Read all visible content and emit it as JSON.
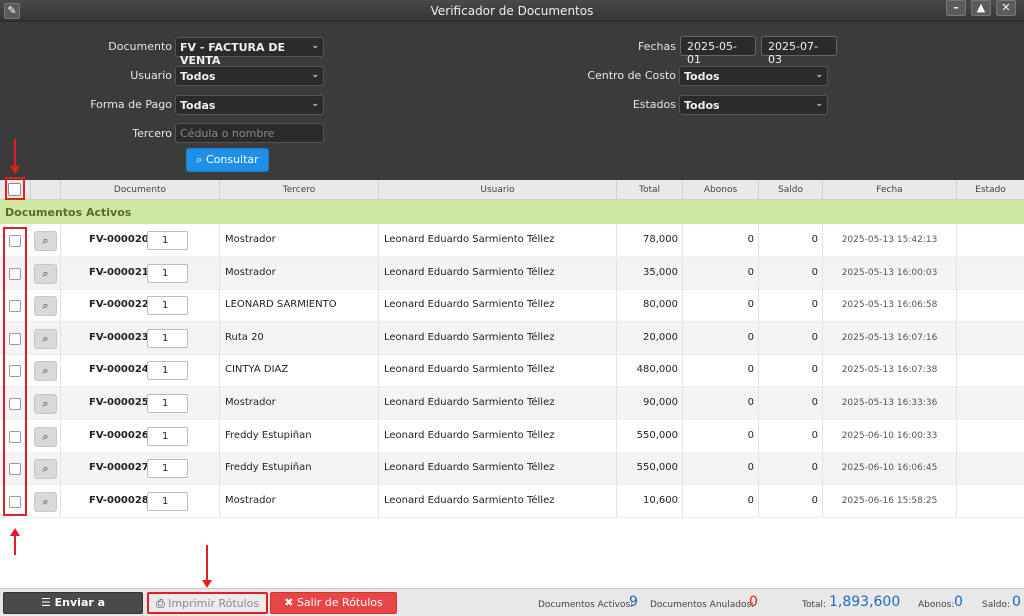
{
  "window": {
    "title": "Verificador de Documentos",
    "controls": [
      "–",
      "▲",
      "✕"
    ]
  },
  "filters": {
    "documento_label": "Documento",
    "documento_value": "FV - FACTURA DE VENTA",
    "usuario_label": "Usuario",
    "usuario_value": "Todos",
    "forma_pago_label": "Forma de Pago",
    "forma_pago_value": "Todas",
    "tercero_label": "Tercero",
    "tercero_placeholder": "Cédula o nombre",
    "fechas_label": "Fechas",
    "fecha_desde": "2025-05-01",
    "fecha_hasta": "2025-07-03",
    "centro_costo_label": "Centro de Costo",
    "centro_costo_value": "Todos",
    "estados_label": "Estados",
    "estados_value": "Todos",
    "consultar_label": "Consultar"
  },
  "table": {
    "columns": [
      "Documento",
      "Tercero",
      "Usuario",
      "Total",
      "Abonos",
      "Saldo",
      "Fecha",
      "Estado"
    ],
    "group_label": "Documentos Activos",
    "rows": [
      {
        "doc": "FV-000020",
        "qty": "1",
        "tercero": "Mostrador",
        "usuario": "Leonard Eduardo Sarmiento Téllez",
        "total": "78,000",
        "abonos": "0",
        "saldo": "0",
        "fecha": "2025-05-13 15:42:13",
        "estado": ""
      },
      {
        "doc": "FV-000021",
        "qty": "1",
        "tercero": "Mostrador",
        "usuario": "Leonard Eduardo Sarmiento Téllez",
        "total": "35,000",
        "abonos": "0",
        "saldo": "0",
        "fecha": "2025-05-13 16:00:03",
        "estado": ""
      },
      {
        "doc": "FV-000022",
        "qty": "1",
        "tercero": "LEONARD SARMIENTO",
        "usuario": "Leonard Eduardo Sarmiento Téllez",
        "total": "80,000",
        "abonos": "0",
        "saldo": "0",
        "fecha": "2025-05-13 16:06:58",
        "estado": ""
      },
      {
        "doc": "FV-000023",
        "qty": "1",
        "tercero": "Ruta 20",
        "usuario": "Leonard Eduardo Sarmiento Téllez",
        "total": "20,000",
        "abonos": "0",
        "saldo": "0",
        "fecha": "2025-05-13 16:07:16",
        "estado": ""
      },
      {
        "doc": "FV-000024",
        "qty": "1",
        "tercero": "CINTYA DIAZ",
        "usuario": "Leonard Eduardo Sarmiento Téllez",
        "total": "480,000",
        "abonos": "0",
        "saldo": "0",
        "fecha": "2025-05-13 16:07:38",
        "estado": ""
      },
      {
        "doc": "FV-000025",
        "qty": "1",
        "tercero": "Mostrador",
        "usuario": "Leonard Eduardo Sarmiento Téllez",
        "total": "90,000",
        "abonos": "0",
        "saldo": "0",
        "fecha": "2025-05-13 16:33:36",
        "estado": ""
      },
      {
        "doc": "FV-000026",
        "qty": "1",
        "tercero": "Freddy Estupiñan",
        "usuario": "Leonard Eduardo Sarmiento Téllez",
        "total": "550,000",
        "abonos": "0",
        "saldo": "0",
        "fecha": "2025-06-10 16:00:33",
        "estado": ""
      },
      {
        "doc": "FV-000027",
        "qty": "1",
        "tercero": "Freddy Estupiñan",
        "usuario": "Leonard Eduardo Sarmiento Téllez",
        "total": "550,000",
        "abonos": "0",
        "saldo": "0",
        "fecha": "2025-06-10 16:06:45",
        "estado": ""
      },
      {
        "doc": "FV-000028",
        "qty": "1",
        "tercero": "Mostrador",
        "usuario": "Leonard Eduardo Sarmiento Téllez",
        "total": "10,600",
        "abonos": "0",
        "saldo": "0",
        "fecha": "2025-06-16 15:58:25",
        "estado": ""
      }
    ]
  },
  "footer": {
    "enviar_label": "Enviar a Facturación",
    "imprimir_label": "Imprimir Rótulos",
    "salir_label": "Salir de Rótulos",
    "activos_label": "Documentos Activos:",
    "activos_value": "9",
    "anulados_label": "Documentos Anulados:",
    "anulados_value": "0",
    "total_label": "Total:",
    "total_value": "1,893,600",
    "abonos_label": "Abonos:",
    "abonos_value": "0",
    "saldo_label": "Saldo:",
    "saldo_value": "0"
  },
  "colors": {
    "accent": "#1e90e8",
    "group_bg": "#cfe8a0",
    "danger": "#e84545",
    "annotation": "#e02020"
  }
}
